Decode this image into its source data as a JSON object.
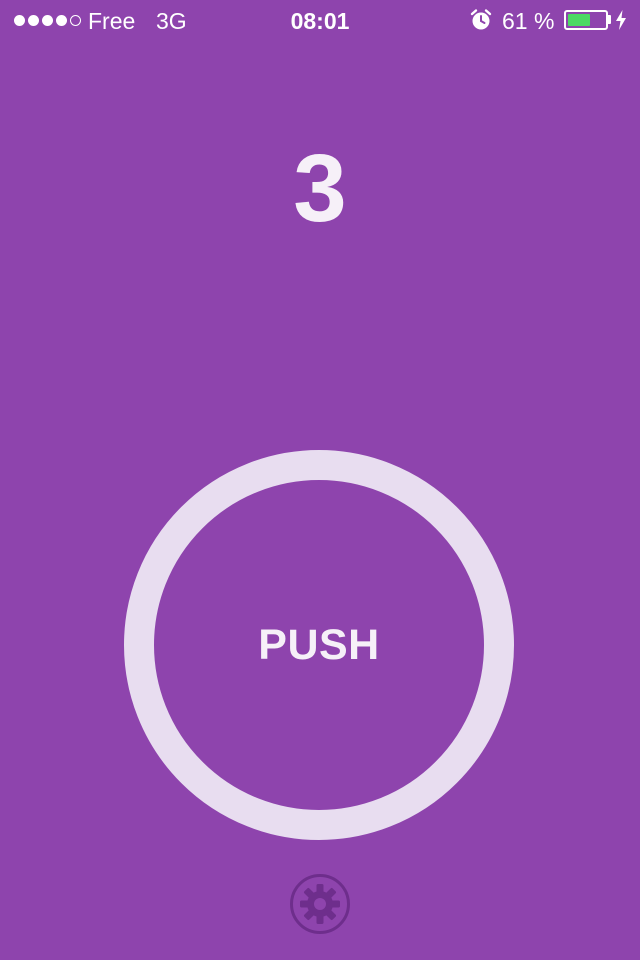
{
  "status_bar": {
    "carrier": "Free",
    "network": "3G",
    "time": "08:01",
    "battery_percent_text": "61 %",
    "battery_level": 0.61,
    "battery_fill_color": "#4CD964",
    "signal_strength": 4,
    "signal_max": 5,
    "icons": [
      "alarm-icon",
      "battery-icon",
      "charging-bolt-icon"
    ]
  },
  "main": {
    "counter_value": "3",
    "push_label": "PUSH",
    "settings_icon": "gear-icon"
  },
  "colors": {
    "background": "#8E44AD",
    "ring": "#E8DDF0",
    "text": "#F6F0F8",
    "gear": "#6E2E8C"
  }
}
